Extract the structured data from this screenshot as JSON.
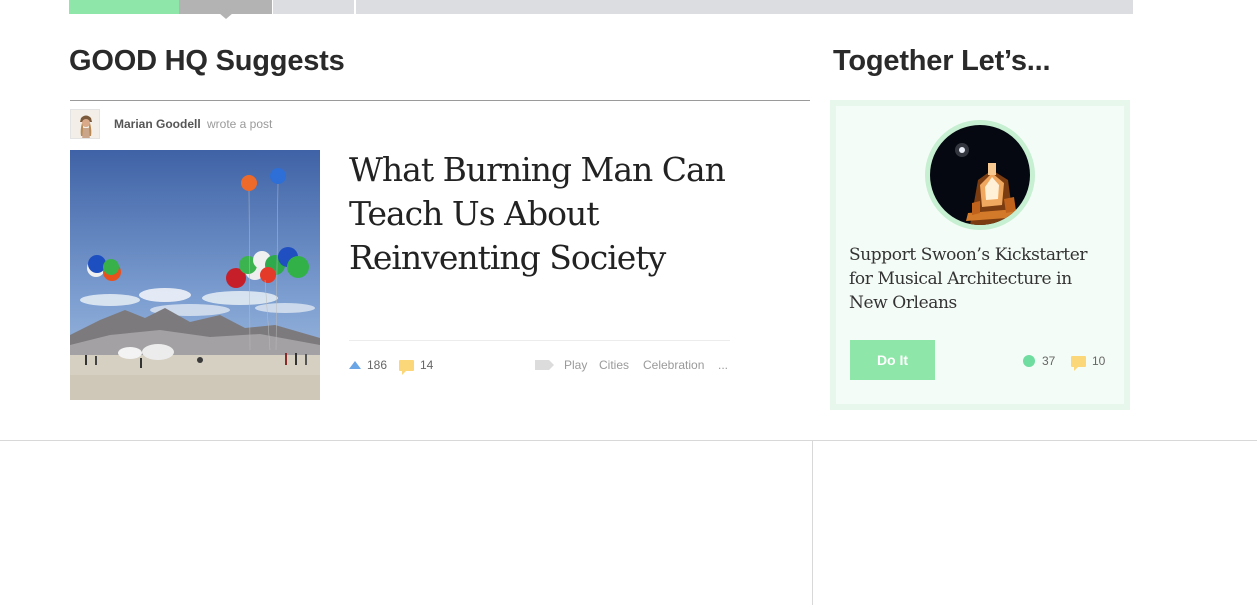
{
  "nav_strip": {
    "progress_color": "#8ee6a8",
    "active_color": "#b3b3b3",
    "track_color": "#dcdde0"
  },
  "suggests": {
    "title": "GOOD HQ Suggests"
  },
  "post": {
    "author_name": "Marian Goodell",
    "author_action": "wrote a post",
    "title": "What Burning Man Can Teach Us About Reinventing Society",
    "upvotes": "186",
    "comments": "14",
    "tags": [
      "Play",
      "Cities",
      "Celebration",
      "..."
    ]
  },
  "together": {
    "title": "Together Let’s...",
    "card_title": "Support Swoon’s Kickstarter for Musical Architecture in New Orleans",
    "button_label": "Do It",
    "participants": "37",
    "comments": "10"
  },
  "colors": {
    "accent_green": "#8ee6a8",
    "upvote_blue": "#6aa5e6",
    "comment_yellow": "#fbd77a"
  }
}
